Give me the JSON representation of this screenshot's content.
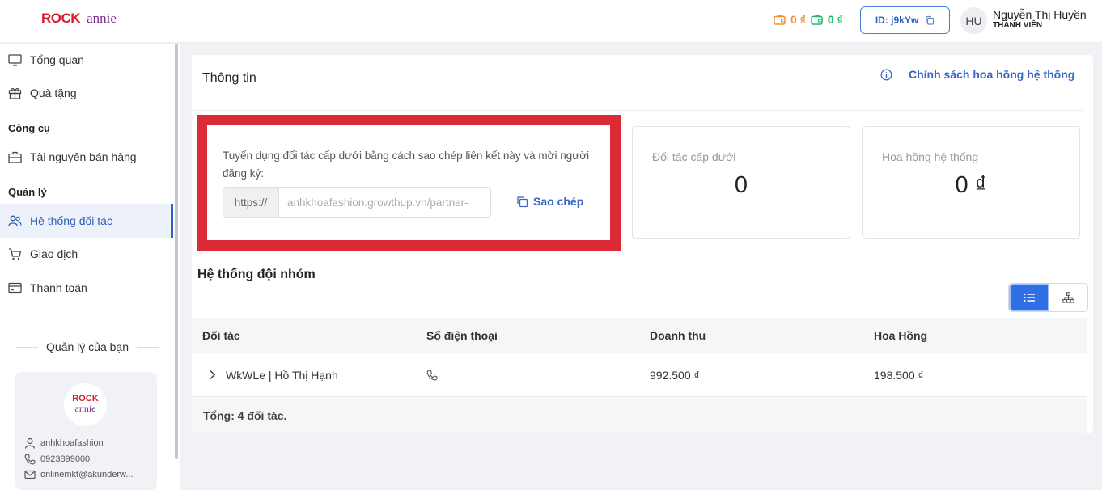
{
  "header": {
    "logo_rock": "ROCK",
    "logo_annie": "annie",
    "wallet_1": "0 ₫",
    "wallet_2": "0 ₫",
    "id_label": "ID: j9kYw",
    "avatar_initials": "HU",
    "user_name": "Nguyễn Thị Huyền",
    "user_role": "THÀNH VIÊN",
    "colors": {
      "wallet_1": "#f0922b",
      "wallet_2": "#1fb96b",
      "accent": "#3566c8"
    }
  },
  "sidebar": {
    "items": [
      {
        "label": "Tổng quan",
        "icon": "monitor-icon"
      },
      {
        "label": "Quà tặng",
        "icon": "gift-icon"
      },
      {
        "label": "Tài nguyên bán hàng",
        "icon": "briefcase-icon"
      },
      {
        "label": "Hệ thống đối tác",
        "icon": "users-icon",
        "active": true
      },
      {
        "label": "Giao dịch",
        "icon": "cart-icon"
      },
      {
        "label": "Thanh toán",
        "icon": "payment-icon"
      }
    ],
    "sections": {
      "tools": "Công cụ",
      "management": "Quản lý"
    },
    "manager": {
      "title": "Quản lý của bạn",
      "logo_rock": "ROCK",
      "logo_annie": "annie",
      "username": "anhkhoafashion",
      "phone": "0923899000",
      "email": "onlinemkt@akunderw..."
    }
  },
  "main": {
    "title": "Thông tin",
    "policy_link": "Chính sách hoa hồng hệ thống",
    "recruit_text": "Tuyển dụng đối tác cấp dưới bằng cách sao chép liên kết này và mời người đăng ký:",
    "link_prefix": "https://",
    "link_value": "anhkhoafashion.growthup.vn/partner-",
    "copy_label": "Sao chép",
    "stats": [
      {
        "label": "Đối tác cấp dưới",
        "value": "0"
      },
      {
        "label": "Hoa hồng hệ thống",
        "value": "0 ₫"
      }
    ],
    "team_title": "Hệ thống đội nhóm",
    "table": {
      "headers": [
        "Đối tác",
        "Số điện thoại",
        "Doanh thu",
        "Hoa Hồng"
      ],
      "rows": [
        {
          "partner": "WkWLe | Hồ Thị Hạnh",
          "phone": "",
          "revenue": "992.500 ₫",
          "commission": "198.500 ₫"
        }
      ],
      "footer": "Tổng: 4 đối tác."
    }
  }
}
